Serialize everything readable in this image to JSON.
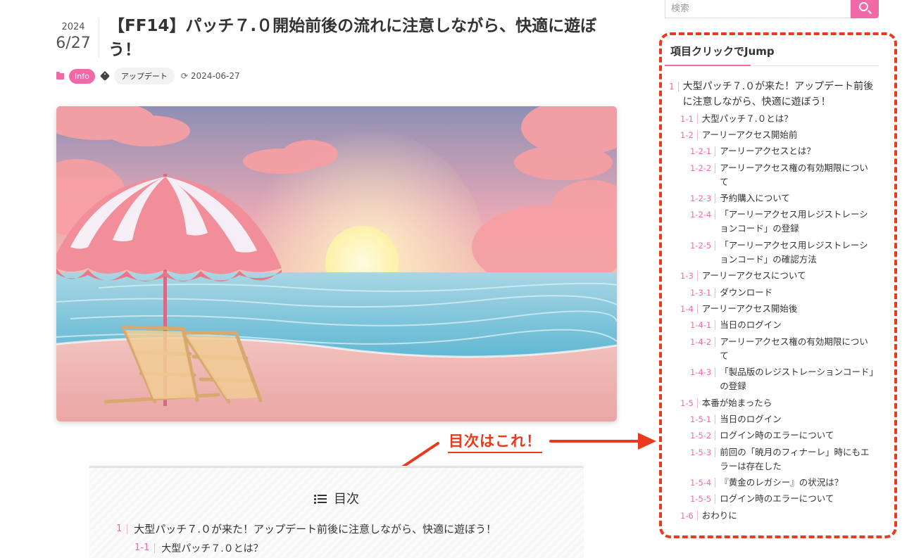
{
  "post": {
    "year": "2024",
    "month_day": "6/27",
    "title": "【FF14】パッチ７.０開始前後の流れに注意しながら、快適に遊ぼう！",
    "category": "Info",
    "tag": "アップデート",
    "updated": "2024-06-27"
  },
  "annotation": {
    "label": "目次はこれ！",
    "color": "#ea3a1e"
  },
  "toc": {
    "title": "目次",
    "items": [
      {
        "num": "1",
        "text": "大型パッチ７.０が来た！アップデート前後に注意しながら、快適に遊ぼう！"
      },
      {
        "num": "1-1",
        "text": "大型パッチ７.０とは？"
      }
    ]
  },
  "sidebar": {
    "search_placeholder": "検索",
    "widget_title": "項目クリックでJump",
    "items": [
      {
        "num": "1",
        "text": "大型パッチ７.０が来た！アップデート前後に注意しながら、快適に遊ぼう！"
      },
      {
        "num": "1-1",
        "text": "大型パッチ７.０とは？"
      },
      {
        "num": "1-2",
        "text": "アーリーアクセス開始前"
      },
      {
        "num": "1-2-1",
        "text": "アーリーアクセスとは？"
      },
      {
        "num": "1-2-2",
        "text": "アーリーアクセス権の有効期限について"
      },
      {
        "num": "1-2-3",
        "text": "予約購入について"
      },
      {
        "num": "1-2-4",
        "text": "「アーリーアクセス用レジストレーションコード」の登録"
      },
      {
        "num": "1-2-5",
        "text": "「アーリーアクセス用レジストレーションコード」の確認方法"
      },
      {
        "num": "1-3",
        "text": "アーリーアクセスについて"
      },
      {
        "num": "1-3-1",
        "text": "ダウンロード"
      },
      {
        "num": "1-4",
        "text": "アーリーアクセス開始後"
      },
      {
        "num": "1-4-1",
        "text": "当日のログイン"
      },
      {
        "num": "1-4-2",
        "text": "アーリーアクセス権の有効期限について"
      },
      {
        "num": "1-4-3",
        "text": "「製品版のレジストレーションコード」の登録"
      },
      {
        "num": "1-5",
        "text": "本番が始まったら"
      },
      {
        "num": "1-5-1",
        "text": "当日のログイン"
      },
      {
        "num": "1-5-2",
        "text": "ログイン時のエラーについて"
      },
      {
        "num": "1-5-3",
        "text": "前回の「暁月のフィナーレ」時にもエラーは存在した"
      },
      {
        "num": "1-5-4",
        "text": "『黄金のレガシー』の状況は？"
      },
      {
        "num": "1-5-5",
        "text": "ログイン時のエラーについて"
      },
      {
        "num": "1-6",
        "text": "おわりに"
      }
    ]
  },
  "colors": {
    "accent": "#f06aa8",
    "annotation": "#ea3a1e"
  }
}
